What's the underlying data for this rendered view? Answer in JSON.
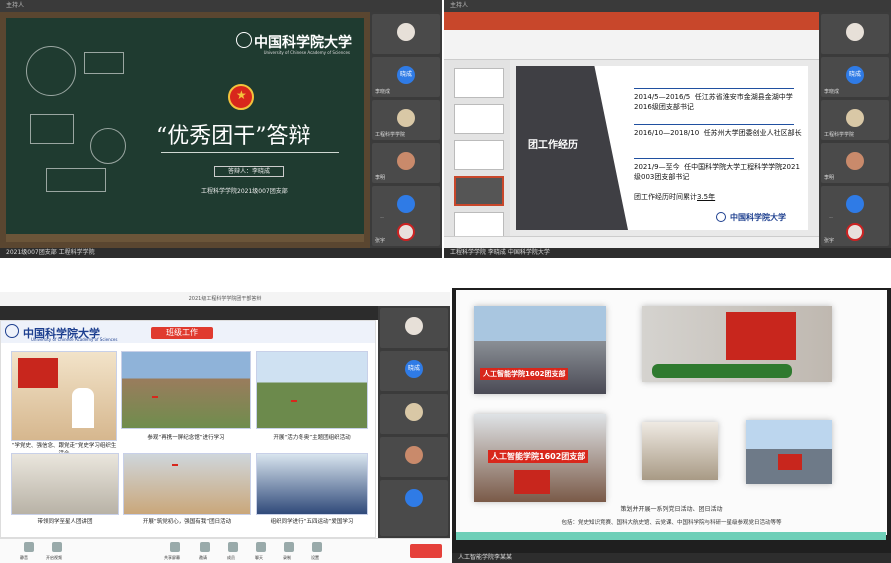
{
  "q1": {
    "topbar": "主持人",
    "logo_cn": "中国科学院大学",
    "logo_en": "University of Chinese Academy of Sciences",
    "title": "“优秀团干”答辩",
    "speaker": "答辩人：李晓成",
    "subtitle": "工程科学学院2021级007团支部",
    "bottom_name": "2021级007团支部 工程科学学院",
    "participants": [
      "",
      "李晓成",
      "工程科学学院",
      "李明",
      "王鹏",
      "张宇"
    ]
  },
  "q2": {
    "topbar": "主持人",
    "section_title": "团工作经历",
    "items": [
      {
        "date": "2014/5—2016/5",
        "text": "任江苏省淮安市金湖县金湖中学2016级团支部书记"
      },
      {
        "date": "2016/10—2018/10",
        "text": "任苏州大学团委创业人社区部长"
      },
      {
        "date": "2021/9—至今",
        "text": "任中国科学院大学工程科学学院2021级003团支部书记"
      }
    ],
    "total_prefix": "团工作经历时间累计",
    "total_value": "3.5年",
    "logo_cn": "中国科学院大学",
    "bottom_name": "工程科学学院 李晓成 中国科学院大学",
    "participants": [
      "",
      "李晓成",
      "工程科学学院",
      "李明",
      "王鹏",
      "张宇"
    ]
  },
  "q3": {
    "top": "2021级工程科学学院团干部答辩",
    "logo_cn": "中国科学院大学",
    "logo_en": "University of Chinese Academy of Sciences",
    "section_title": "班级工作",
    "captions": [
      "“学党史、强信念、跟党走”党史学习组织生活会",
      "参观“再携一屏纪念馆”进行学习",
      "开展“活力冬奥”主题团组织活动",
      "带领同学至星人团讲团",
      "开展“筑党初心，强国有我”团日活动",
      "组织同学进行“五四运动”爱国学习"
    ],
    "toolbar": [
      "静音",
      "开启视频",
      "共享屏幕",
      "邀请",
      "成员",
      "聊天",
      "录制",
      "设置"
    ]
  },
  "q4": {
    "banners": [
      "人工智能学院1602团支部",
      "人工智能学院1602团支部"
    ],
    "caption1": "策划并开展一系列党日活动、团日活动",
    "caption2": "包括：党史知识竞赛、国科大航史馆、云党课、中国科学院与科研一星级参观党日活动等等",
    "bottom_name": "人工智能学院李某某"
  }
}
